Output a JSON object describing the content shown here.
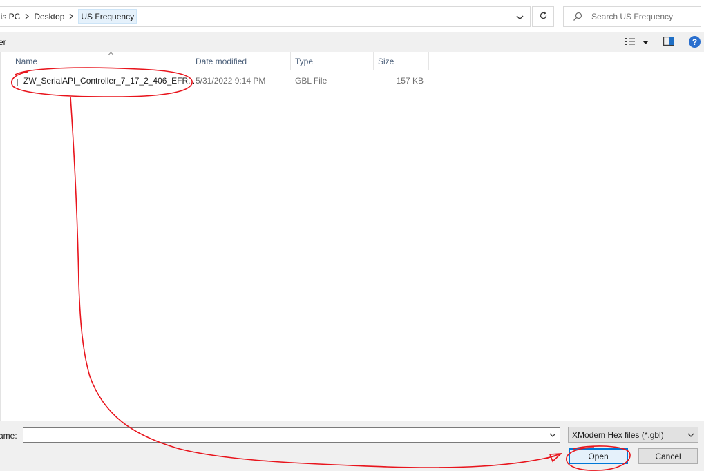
{
  "address_bar": {
    "crumbs": [
      "his PC",
      "Desktop",
      "US Frequency"
    ],
    "search_placeholder": "Search US Frequency"
  },
  "toolbar": {
    "partial_label": "er"
  },
  "columns": [
    "Name",
    "Date modified",
    "Type",
    "Size"
  ],
  "files": [
    {
      "name": "ZW_SerialAPI_Controller_7_17_2_406_EFR...",
      "date_modified": "5/31/2022 9:14 PM",
      "type": "GBL File",
      "size": "157 KB"
    }
  ],
  "bottom": {
    "file_name_label": "ame:",
    "file_name_value": "",
    "file_type_selected": "XModem Hex files (*.gbl)",
    "open_label": "Open",
    "cancel_label": "Cancel"
  },
  "colors": {
    "accent": "#0078d7",
    "annotation": "#e8141c",
    "help": "#2a6fce",
    "header_text": "#4c607a"
  },
  "icons": [
    "chevron-right-icon",
    "chevron-down-icon",
    "refresh-icon",
    "search-icon",
    "view-options-icon",
    "preview-pane-icon",
    "help-icon",
    "file-icon"
  ]
}
